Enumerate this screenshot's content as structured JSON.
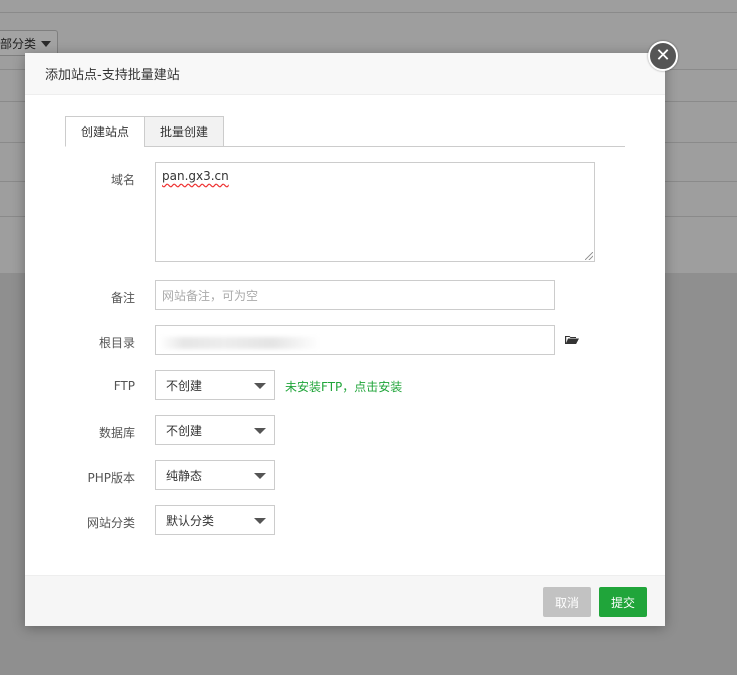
{
  "background": {
    "category_select": "部分类"
  },
  "dialog": {
    "title": "添加站点-支持批量建站",
    "close_glyph": "✕",
    "tabs": [
      {
        "label": "创建站点",
        "active": true
      },
      {
        "label": "批量创建",
        "active": false
      }
    ],
    "domain": {
      "label": "域名",
      "value": "pan.gx3.cn"
    },
    "remark": {
      "label": "备注",
      "placeholder": "网站备注，可为空"
    },
    "root_dir": {
      "label": "根目录",
      "icon": "folder-open-icon"
    },
    "ftp": {
      "label": "FTP",
      "value": "不创建",
      "hint": "未安装FTP，点击安装"
    },
    "database": {
      "label": "数据库",
      "value": "不创建"
    },
    "php_version": {
      "label": "PHP版本",
      "value": "纯静态"
    },
    "site_category": {
      "label": "网站分类",
      "value": "默认分类"
    },
    "buttons": {
      "cancel": "取消",
      "submit": "提交"
    }
  },
  "colors": {
    "accent": "#20a53a",
    "cancel": "#c2c2c2",
    "overlay": "#8f8f8f"
  }
}
